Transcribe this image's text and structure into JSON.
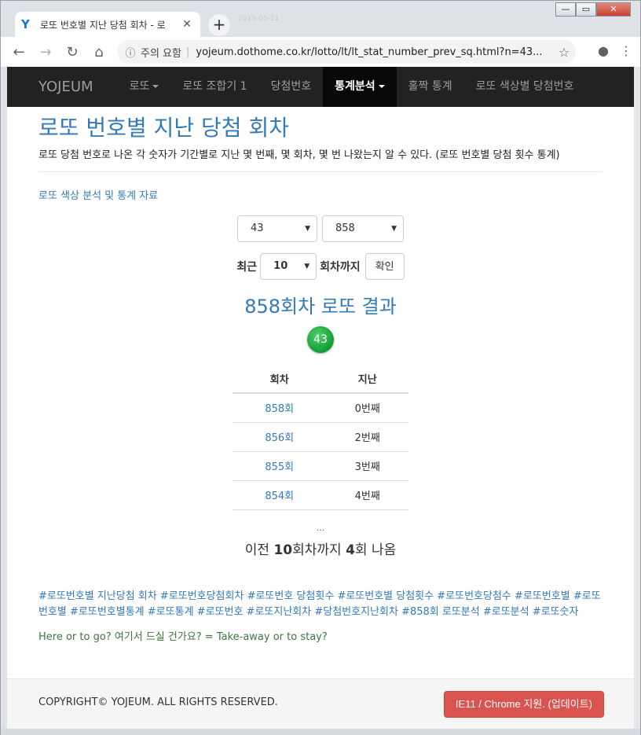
{
  "browser": {
    "tab_title": "로또 번호별 지난 당첨 회차 - 로",
    "new_tab_symbol": "+",
    "close_symbol": "✕",
    "timestamp": "2019-05-11",
    "security_text": "주의 요함",
    "url": "yojeum.dothome.co.kr/lotto/lt/lt_stat_number_prev_sq.html?n=43..."
  },
  "navbar": {
    "brand": "YOJEUM",
    "items": [
      {
        "label": "로또",
        "dropdown": true
      },
      {
        "label": "로또 조합기 1"
      },
      {
        "label": "당첨번호"
      },
      {
        "label": "통계분석",
        "dropdown": true,
        "active": true
      },
      {
        "label": "홀짝 통계"
      },
      {
        "label": "로또 색상별 당첨번호"
      }
    ]
  },
  "header": {
    "title": "로또 번호별 지난 당첨 회차",
    "description": "로또 당첨 번호로 나온 각 숫자가 기간별로 지난 몇 번째, 몇 회차, 몇 번 나왔는지 알 수 있다. (로또 번호별 당첨 횟수 통계)"
  },
  "color_link": "로또 색상 분석 및 통계 자료",
  "form": {
    "number_select": "43",
    "draw_select": "858",
    "recent_label": "최근",
    "count_select": "10",
    "until_label": "회차까지",
    "confirm_button": "확인"
  },
  "result": {
    "title": "858회차 로또 결과",
    "ball": "43",
    "ball_color": "#1fae45",
    "columns": [
      "회차",
      "지난"
    ],
    "rows": [
      [
        "858회",
        "0번째"
      ],
      [
        "856회",
        "2번째"
      ],
      [
        "855회",
        "3번째"
      ],
      [
        "854회",
        "4번째"
      ]
    ],
    "ellipsis": "...",
    "summary_prefix": "이전 ",
    "summary_count": "10",
    "summary_mid": "회차까지 ",
    "summary_hits": "4",
    "summary_suffix": "회 나옴"
  },
  "tags": [
    "#로또번호별 지난당첨 회차",
    "#로또번호당첨회차",
    "#로또번호 당첨횟수",
    "#로또번호별 당첨횟수",
    "#로또번호당첨수",
    "#로또번호별",
    "#로또번호별",
    "#로또번호별통계",
    "#로또통계",
    "#로또번호",
    "#로또지난회차",
    "#당첨번호지난회차",
    "#858회 로또분석",
    "#로또분석",
    "#로또숫자"
  ],
  "tagline": "Here or to go? 여기서 드실 건가요? = Take-away or to stay?",
  "footer": {
    "copyright": "COPYRIGHT© YOJEUM. ALL RIGHTS RESERVED.",
    "update_button": "IE11 / Chrome 지원. (업데이트)",
    "button_color": "#d9534f"
  }
}
